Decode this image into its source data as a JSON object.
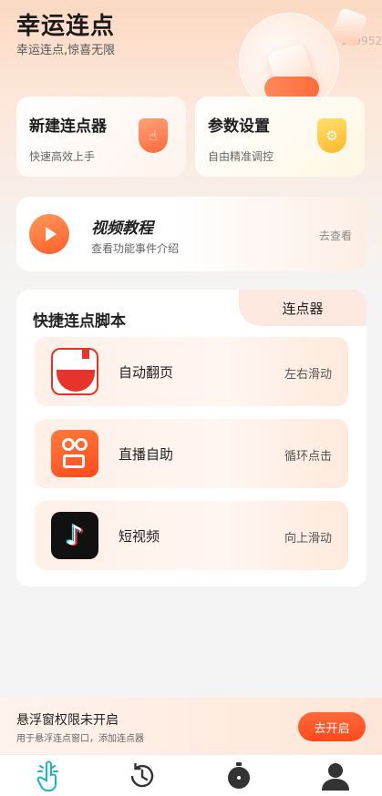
{
  "header": {
    "title": "幸运连点",
    "subtitle": "幸运连点,惊喜无限",
    "number_text": "119952"
  },
  "features": [
    {
      "title": "新建连点器",
      "subtitle": "快速高效上手",
      "icon": "hand-tap-icon",
      "color": "#ff6a3a"
    },
    {
      "title": "参数设置",
      "subtitle": "自由精准调控",
      "icon": "gear-icon",
      "color": "#ffb72a"
    }
  ],
  "video": {
    "title": "视频教程",
    "subtitle": "查看功能事件介绍",
    "link": "去查看",
    "icon": "play-icon"
  },
  "scripts": {
    "title": "快捷连点脚本",
    "tab": "连点器",
    "items": [
      {
        "name": "自动翻页",
        "action": "左右滑动",
        "icon": "red-app-icon"
      },
      {
        "name": "直播自助",
        "action": "循环点击",
        "icon": "kuaishou-icon"
      },
      {
        "name": "短视频",
        "action": "向上滑动",
        "icon": "tiktok-icon"
      }
    ]
  },
  "banner": {
    "title": "悬浮窗权限未开启",
    "subtitle": "用于悬浮连点窗口，添加连点器",
    "button": "去开启"
  },
  "nav": {
    "items": [
      {
        "icon": "tap-icon",
        "active": true
      },
      {
        "icon": "history-icon",
        "active": false
      },
      {
        "icon": "stopwatch-icon",
        "active": false
      },
      {
        "icon": "profile-icon",
        "active": false
      }
    ]
  },
  "colors": {
    "accent": "#ff5d2a",
    "nav_active": "#19b4c9",
    "nav_inactive": "#333333"
  }
}
